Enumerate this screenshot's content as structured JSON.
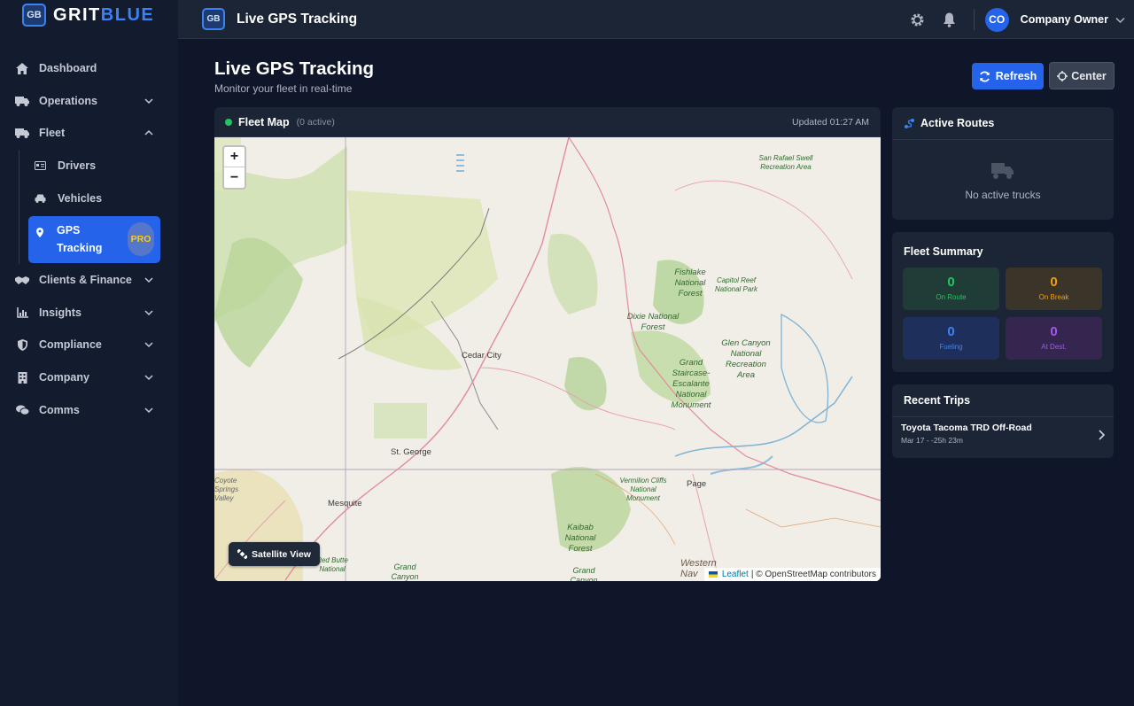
{
  "brand": {
    "badge": "GB",
    "name_part1": "GRIT",
    "name_part2": "BLUE"
  },
  "sidebar": {
    "items": [
      {
        "label": "Dashboard",
        "icon": "home-icon"
      },
      {
        "label": "Operations",
        "icon": "truck-icon"
      },
      {
        "label": "Fleet",
        "icon": "truck-icon"
      },
      {
        "label": "Drivers",
        "icon": "id-card-icon"
      },
      {
        "label": "Vehicles",
        "icon": "car-icon"
      },
      {
        "label": "GPS Tracking",
        "line1": "GPS",
        "line2": "Tracking",
        "icon": "map-pin-icon",
        "badge": "PRO"
      },
      {
        "label": "Clients & Finance",
        "icon": "handshake-icon"
      },
      {
        "label": "Insights",
        "icon": "chart-icon"
      },
      {
        "label": "Compliance",
        "icon": "shield-icon"
      },
      {
        "label": "Company",
        "icon": "building-icon"
      },
      {
        "label": "Comms",
        "icon": "chat-icon"
      }
    ]
  },
  "topbar": {
    "badge": "GB",
    "title": "Live GPS Tracking",
    "avatar": "CO",
    "user": "Company Owner"
  },
  "page": {
    "title": "Live GPS Tracking",
    "subtitle": "Monitor your fleet in real-time",
    "refresh_label": "Refresh",
    "center_label": "Center"
  },
  "map": {
    "title": "Fleet Map",
    "count": "(0 active)",
    "updated": "Updated 01:27 AM",
    "zoom_in": "+",
    "zoom_out": "−",
    "satellite_label": "Satellite View",
    "attribution_link": "Leaflet",
    "attribution_text": "| © OpenStreetMap contributors",
    "places": {
      "cedar_city": "Cedar City",
      "st_george": "St. George",
      "mesquite": "Mesquite",
      "page": "Page",
      "coyote": "Coyote Springs Valley",
      "western_nav": "Western Nav"
    },
    "areas": {
      "san_rafael": "San Rafael Swell Recreation Area",
      "fishlake": "Fishlake National Forest",
      "capitol_reef": "Capitol Reef National Park",
      "dixie": "Dixie National Forest",
      "glen_canyon": "Glen Canyon National Recreation Area",
      "grand_staircase": "Grand Staircase-Escalante National Monument",
      "vermilion": "Vermilion Cliffs National Monument",
      "kaibab": "Kaibab National Forest",
      "red_butte": "Red Butte National",
      "grand_canyon_1": "Grand Canyon",
      "grand_canyon_2": "Grand Canyon"
    }
  },
  "routes": {
    "title": "Active Routes",
    "empty": "No active trucks"
  },
  "summary": {
    "title": "Fleet Summary",
    "stats": [
      {
        "value": "0",
        "label": "On Route",
        "color": "#22c55e"
      },
      {
        "value": "0",
        "label": "On Break",
        "color": "#f59e0b"
      },
      {
        "value": "0",
        "label": "Fueling",
        "color": "#3b82f6"
      },
      {
        "value": "0",
        "label": "At Dest.",
        "color": "#a855f7"
      }
    ]
  },
  "trips": {
    "title": "Recent Trips",
    "items": [
      {
        "name": "Toyota Tacoma TRD Off-Road",
        "meta": "Mar 17 - -25h 23m"
      }
    ]
  }
}
